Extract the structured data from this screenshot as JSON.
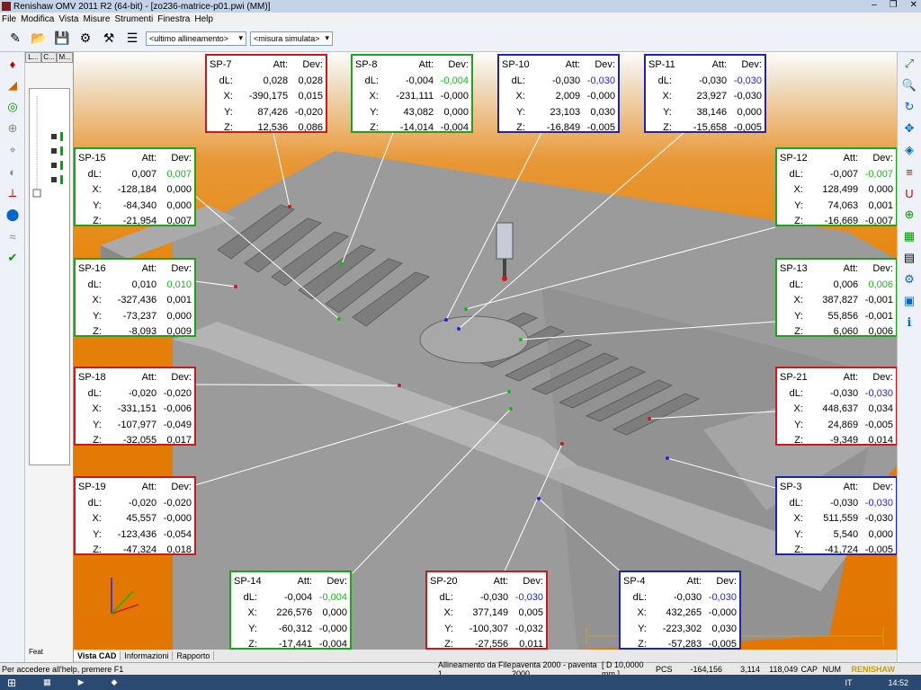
{
  "window": {
    "title": "Renishaw OMV 2011 R2 (64-bit) - [zo236-matrice-p01.pwi (MM)]"
  },
  "menu": [
    "File",
    "Modifica",
    "Vista",
    "Misure",
    "Strumenti",
    "Finestra",
    "Help"
  ],
  "toolbar": {
    "alignment_select": "<ultimo allineamento>",
    "measure_select": "<misura simulata>"
  },
  "tree_tabs": [
    "L...",
    "C...",
    "M..."
  ],
  "feature_label": "Feat",
  "view_tabs": [
    "Vista CAD",
    "Informazioni",
    "Rapporto"
  ],
  "status": {
    "help": "Per accedere all'help, premere F1",
    "alignment": "Allineamento da File 1",
    "paventa1": "paventa 2000 - paventa 2000",
    "dscale": "[ D 10,0000 mm ]",
    "pcs": "PCS",
    "x": "-164,156",
    "y": "3,114",
    "z": "118,049",
    "cap": "CAP",
    "num": "NUM",
    "brand": "RENISHAW"
  },
  "taskbar": {
    "lang": "IT",
    "time": "14:52"
  },
  "colors": {
    "ok": "#16b816",
    "warn": "#2020ff",
    "border_green": "#1aa51a",
    "border_red": "#d01818",
    "border_blue": "#1a24b8"
  },
  "headers": {
    "att": "Att:",
    "dev": "Dev:",
    "dl": "dL:",
    "x": "X:",
    "y": "Y:",
    "z": "Z:"
  },
  "points": [
    {
      "id": "SP-7",
      "dl_att": "0,028",
      "dl_dev": "0,028",
      "x_att": "-390,175",
      "x_dev": "0,015",
      "y_att": "87,426",
      "y_dev": "-0,020",
      "z_att": "12,536",
      "z_dev": "0,086",
      "status": "red",
      "dev_color": "none"
    },
    {
      "id": "SP-8",
      "dl_att": "-0,004",
      "dl_dev": "-0,004",
      "x_att": "-231,111",
      "x_dev": "-0,000",
      "y_att": "43,082",
      "y_dev": "0,000",
      "z_att": "-14,014",
      "z_dev": "-0,004",
      "status": "green",
      "dev_color": "green"
    },
    {
      "id": "SP-10",
      "dl_att": "-0,030",
      "dl_dev": "-0,030",
      "x_att": "2,009",
      "x_dev": "-0,000",
      "y_att": "23,103",
      "y_dev": "0,030",
      "z_att": "-16,849",
      "z_dev": "-0,005",
      "status": "blue",
      "dev_color": "blue"
    },
    {
      "id": "SP-11",
      "dl_att": "-0,030",
      "dl_dev": "-0,030",
      "x_att": "23,927",
      "x_dev": "-0,030",
      "y_att": "38,146",
      "y_dev": "0,000",
      "z_att": "-15,658",
      "z_dev": "-0,005",
      "status": "blue",
      "dev_color": "blue"
    },
    {
      "id": "SP-15",
      "dl_att": "0,007",
      "dl_dev": "0,007",
      "x_att": "-128,184",
      "x_dev": "0,000",
      "y_att": "-84,340",
      "y_dev": "0,000",
      "z_att": "-21,954",
      "z_dev": "0,007",
      "status": "green",
      "dev_color": "green"
    },
    {
      "id": "SP-12",
      "dl_att": "-0,007",
      "dl_dev": "-0,007",
      "x_att": "128,499",
      "x_dev": "0,000",
      "y_att": "74,063",
      "y_dev": "0,001",
      "z_att": "-16,669",
      "z_dev": "-0,007",
      "status": "green",
      "dev_color": "green"
    },
    {
      "id": "SP-16",
      "dl_att": "0,010",
      "dl_dev": "0,010",
      "x_att": "-327,436",
      "x_dev": "0,001",
      "y_att": "-73,237",
      "y_dev": "0,000",
      "z_att": "-8,093",
      "z_dev": "0,009",
      "status": "green",
      "dev_color": "green"
    },
    {
      "id": "SP-13",
      "dl_att": "0,006",
      "dl_dev": "0,006",
      "x_att": "387,827",
      "x_dev": "-0,001",
      "y_att": "55,856",
      "y_dev": "-0,001",
      "z_att": "6,060",
      "z_dev": "0,006",
      "status": "green",
      "dev_color": "green"
    },
    {
      "id": "SP-18",
      "dl_att": "-0,020",
      "dl_dev": "-0,020",
      "x_att": "-331,151",
      "x_dev": "-0,006",
      "y_att": "-107,977",
      "y_dev": "-0,049",
      "z_att": "-32,055",
      "z_dev": "0,017",
      "status": "red",
      "dev_color": "none"
    },
    {
      "id": "SP-21",
      "dl_att": "-0,030",
      "dl_dev": "-0,030",
      "x_att": "448,637",
      "x_dev": "0,034",
      "y_att": "24,869",
      "y_dev": "-0,005",
      "z_att": "-9,349",
      "z_dev": "0,014",
      "status": "red",
      "dev_color": "blue"
    },
    {
      "id": "SP-19",
      "dl_att": "-0,020",
      "dl_dev": "-0,020",
      "x_att": "45,557",
      "x_dev": "-0,000",
      "y_att": "-123,436",
      "y_dev": "-0,054",
      "z_att": "-47,324",
      "z_dev": "0,018",
      "status": "red",
      "dev_color": "none"
    },
    {
      "id": "SP-3",
      "dl_att": "-0,030",
      "dl_dev": "-0,030",
      "x_att": "511,559",
      "x_dev": "-0,030",
      "y_att": "5,540",
      "y_dev": "0,000",
      "z_att": "-41,724",
      "z_dev": "-0,005",
      "status": "blue",
      "dev_color": "blue"
    },
    {
      "id": "SP-14",
      "dl_att": "-0,004",
      "dl_dev": "-0,004",
      "x_att": "226,576",
      "x_dev": "0,000",
      "y_att": "-60,312",
      "y_dev": "-0,000",
      "z_att": "-17,441",
      "z_dev": "-0,004",
      "status": "green",
      "dev_color": "green"
    },
    {
      "id": "SP-20",
      "dl_att": "-0,030",
      "dl_dev": "-0,030",
      "x_att": "377,149",
      "x_dev": "0,005",
      "y_att": "-100,307",
      "y_dev": "-0,032",
      "z_att": "-27,556",
      "z_dev": "0,011",
      "status": "red",
      "dev_color": "blue"
    },
    {
      "id": "SP-4",
      "dl_att": "-0,030",
      "dl_dev": "-0,030",
      "x_att": "432,265",
      "x_dev": "-0,000",
      "y_att": "-223,302",
      "y_dev": "0,030",
      "z_att": "-57,283",
      "z_dev": "-0,005",
      "status": "blue",
      "dev_color": "blue"
    }
  ]
}
